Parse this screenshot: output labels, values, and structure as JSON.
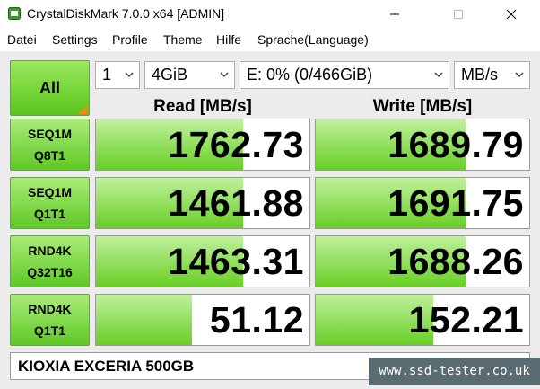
{
  "window": {
    "title": "CrystalDiskMark 7.0.0 x64 [ADMIN]"
  },
  "menu": {
    "items": [
      "Datei",
      "Settings",
      "Profile",
      "Theme",
      "Hilfe",
      "Sprache(Language)"
    ]
  },
  "controls": {
    "all_label": "All",
    "count": "1",
    "size": "4GiB",
    "drive": "E: 0% (0/466GiB)",
    "unit": "MB/s"
  },
  "headers": {
    "read": "Read [MB/s]",
    "write": "Write [MB/s]"
  },
  "tests": [
    {
      "line1": "SEQ1M",
      "line2": "Q8T1",
      "read": "1762.73",
      "write": "1689.79",
      "read_fill": 0.69,
      "write_fill": 0.7
    },
    {
      "line1": "SEQ1M",
      "line2": "Q1T1",
      "read": "1461.88",
      "write": "1691.75",
      "read_fill": 0.69,
      "write_fill": 0.7
    },
    {
      "line1": "RND4K",
      "line2": "Q32T16",
      "read": "1463.31",
      "write": "1688.26",
      "read_fill": 0.69,
      "write_fill": 0.7
    },
    {
      "line1": "RND4K",
      "line2": "Q1T1",
      "read": "51.12",
      "write": "152.21",
      "read_fill": 0.45,
      "write_fill": 0.55
    }
  ],
  "comment": "KIOXIA EXCERIA 500GB",
  "watermark": "www.ssd-tester.co.uk",
  "colors": {
    "accent_green": "#68cf25",
    "corner_orange": "#f08a14",
    "watermark_bg": "#5a6b72"
  }
}
